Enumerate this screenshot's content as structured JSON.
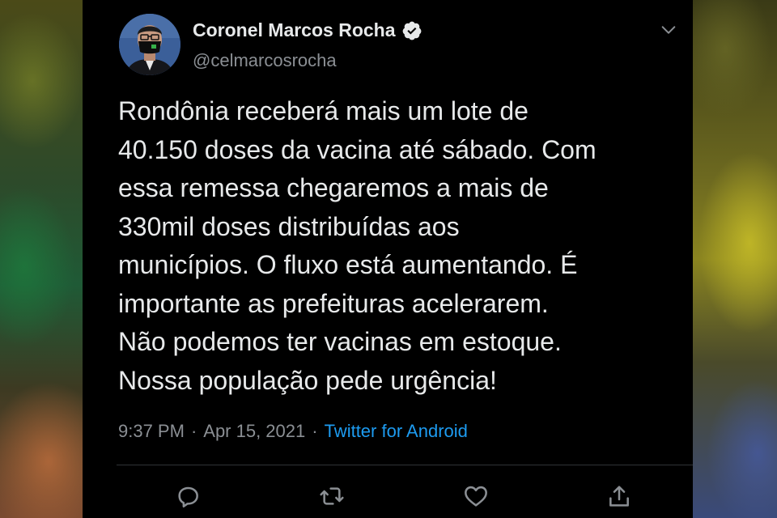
{
  "tweet": {
    "author_name": "Coronel Marcos Rocha",
    "author_handle": "@celmarcosrocha",
    "text": "Rondônia receberá mais um lote de\n40.150 doses da vacina até sábado. Com\nessa remessa chegaremos a mais de\n330mil doses distribuídas aos\nmunicípios. O fluxo está aumentando. É\nimportante as prefeituras acelerarem.\nNão podemos ter vacinas em estoque.\nNossa população pede urgência!",
    "time": "9:37 PM",
    "date": "Apr 15, 2021",
    "separator": "·",
    "source": "Twitter for Android"
  },
  "icons": {
    "verified": "verified-badge-icon",
    "more": "chevron-down-icon",
    "reply": "reply-icon",
    "retweet": "retweet-icon",
    "like": "heart-icon",
    "share": "share-icon"
  },
  "colors": {
    "background": "#000000",
    "text": "#e7e9ea",
    "secondary": "#8b8f94",
    "link": "#1d9bf0"
  }
}
